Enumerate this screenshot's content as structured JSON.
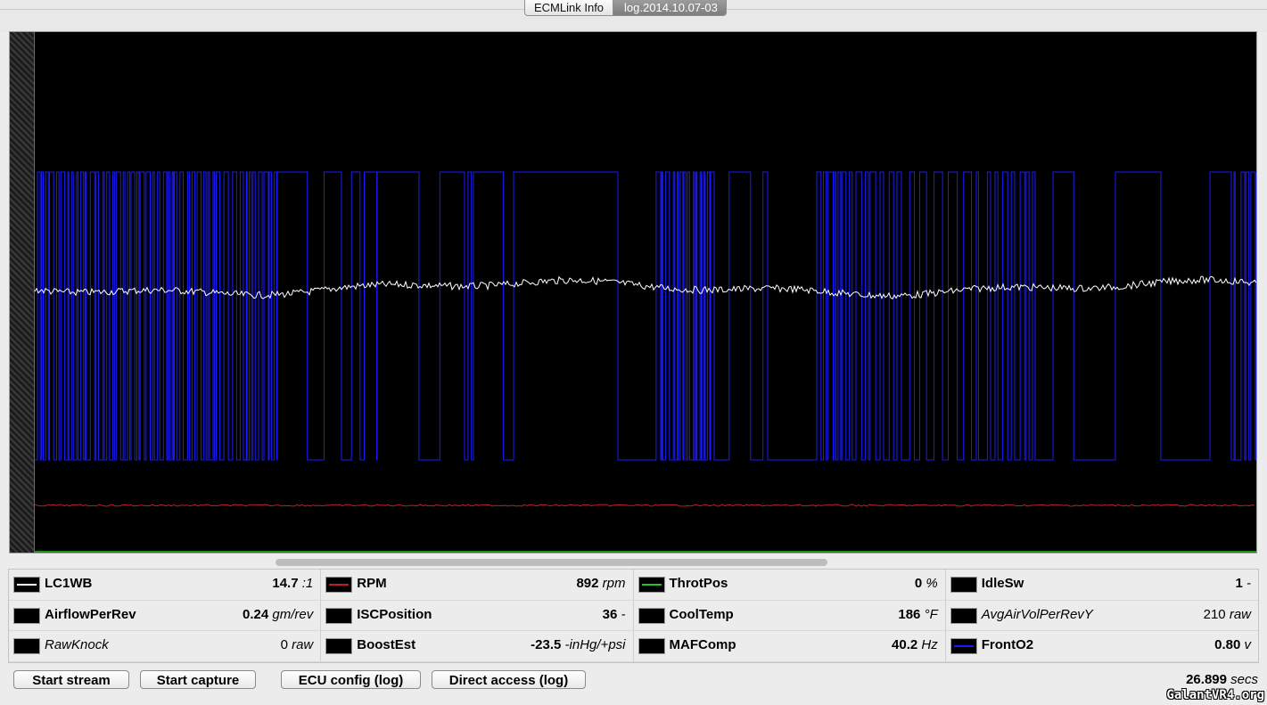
{
  "tabs": [
    {
      "label": "ECMLink Info",
      "active": false
    },
    {
      "label": "log.2014.10.07-03",
      "active": true
    }
  ],
  "chart_data": {
    "type": "line",
    "title": "",
    "xlabel": "",
    "ylabel": "",
    "grid": false,
    "legend": "none",
    "background": "#000000",
    "series": [
      {
        "name": "FrontO2",
        "color": "#1a1aff",
        "shape": "switching square wave between 0.1 v and 0.8 v, dense oscillation bursts"
      },
      {
        "name": "LC1WB",
        "color": "#ffffff",
        "shape": "noisy line around 14.7 :1"
      },
      {
        "name": "RPM",
        "color": "#c0202a",
        "shape": "flat noisy line around 892 rpm"
      },
      {
        "name": "ThrotPos",
        "color": "#22c322",
        "shape": "flat at 0 %"
      }
    ]
  },
  "params": [
    {
      "name": "LC1WB",
      "value": "14.7",
      "unit": ":1",
      "color": "#ffffff",
      "italic": false
    },
    {
      "name": "RPM",
      "value": "892",
      "unit": "rpm",
      "color": "#c0202a",
      "italic": false
    },
    {
      "name": "ThrotPos",
      "value": "0",
      "unit": "%",
      "color": "#22c322",
      "italic": false
    },
    {
      "name": "IdleSw",
      "value": "1",
      "unit": "-",
      "color": "",
      "italic": false
    },
    {
      "name": "AirflowPerRev",
      "value": "0.24",
      "unit": "gm/rev",
      "color": "",
      "italic": false
    },
    {
      "name": "ISCPosition",
      "value": "36",
      "unit": "-",
      "color": "",
      "italic": false
    },
    {
      "name": "CoolTemp",
      "value": "186",
      "unit": "°F",
      "color": "",
      "italic": false
    },
    {
      "name": "AvgAirVolPerRevY",
      "value": "210",
      "unit": "raw",
      "color": "",
      "italic": true
    },
    {
      "name": "RawKnock",
      "value": "0",
      "unit": "raw",
      "color": "",
      "italic": true
    },
    {
      "name": "BoostEst",
      "value": "-23.5",
      "unit": "-inHg/+psi",
      "color": "",
      "italic": false
    },
    {
      "name": "MAFComp",
      "value": "40.2",
      "unit": "Hz",
      "color": "",
      "italic": false
    },
    {
      "name": "FrontO2",
      "value": "0.80",
      "unit": "v",
      "color": "#1a1aff",
      "italic": false
    }
  ],
  "buttons": {
    "start_stream": "Start stream",
    "start_capture": "Start capture",
    "ecu_config": "ECU config (log)",
    "direct_access": "Direct access (log)"
  },
  "elapsed": {
    "value": "26.899",
    "unit": "secs"
  },
  "watermark": "GalantVR4.org"
}
